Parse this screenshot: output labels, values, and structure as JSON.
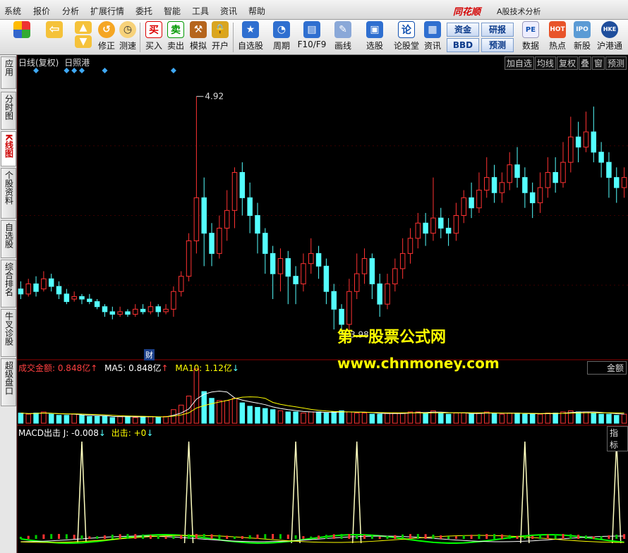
{
  "menu": {
    "items": [
      "系统",
      "报价",
      "分析",
      "扩展行情",
      "委托",
      "智能",
      "工具",
      "资讯",
      "帮助"
    ],
    "brand": "同花顺",
    "app_title": "A股技术分析"
  },
  "toolbar": {
    "buttons": [
      {
        "label": "",
        "icon": "grid-icon"
      },
      {
        "label": "",
        "icon": "back-arrow-icon"
      },
      {
        "label": "",
        "icon": "up-arrow-icon"
      },
      {
        "label": "修正",
        "icon": "fix-icon"
      },
      {
        "label": "测速",
        "icon": "clock-icon"
      },
      {
        "label": "买入",
        "icon": "buy-icon"
      },
      {
        "label": "卖出",
        "icon": "sell-icon"
      },
      {
        "label": "模拟",
        "icon": "hammer-icon"
      },
      {
        "label": "开户",
        "icon": "lock-icon"
      },
      {
        "label": "自选股",
        "icon": "star-icon"
      },
      {
        "label": "周期",
        "icon": "cycle-icon"
      },
      {
        "label": "F10/F9",
        "icon": "f10-icon"
      },
      {
        "label": "画线",
        "icon": "pen-icon"
      },
      {
        "label": "选股",
        "icon": "select-stock-icon"
      },
      {
        "label": "论股堂",
        "icon": "forum-icon"
      },
      {
        "label": "资讯",
        "icon": "news-icon"
      },
      {
        "label": "数据",
        "icon": "pe-icon"
      },
      {
        "label": "热点",
        "icon": "hot-icon"
      },
      {
        "label": "新股",
        "icon": "ipo-icon"
      },
      {
        "label": "沪港通",
        "icon": "hk-connect-icon"
      }
    ],
    "small_buttons": [
      "资金",
      "研报",
      "BBD",
      "预测"
    ]
  },
  "sidebar": {
    "items": [
      "应用",
      "分时图",
      "K线图",
      "个股资料",
      "自选股",
      "综合排名",
      "牛叉诊股",
      "超级盘口"
    ]
  },
  "chart_header": {
    "label": "日线(复权)",
    "stock": "日照港"
  },
  "right_buttons": [
    "加自选",
    "均线",
    "复权",
    "叠",
    "窗",
    "预测"
  ],
  "volume_panel": {
    "label_amount": "成交金额: 0.848亿",
    "label_ma5": "MA5: 0.848亿",
    "label_ma10": "MA10: 1.12亿",
    "right_box": "金额",
    "marker": "财"
  },
  "macd_panel": {
    "label": "MACD出击 J: -0.008",
    "label2": "出击: +0",
    "right_box": "指标"
  },
  "watermark": {
    "line1": "第一股票公式网",
    "line2": "www.chnmoney.com"
  },
  "colors": {
    "up": "#ff3232",
    "down": "#54ffff",
    "bg": "#000000",
    "ma5": "#ffffff",
    "ma10": "#ffff00",
    "watermark": "#ffff00"
  },
  "chart_data": {
    "type": "candlestick",
    "price_high_label": "4.92",
    "price_low_label": "3.98",
    "ylim": [
      3.9,
      5.0
    ],
    "candles": [
      [
        4.16,
        4.14,
        4.19,
        4.12
      ],
      [
        4.14,
        4.18,
        4.2,
        4.13
      ],
      [
        4.18,
        4.15,
        4.21,
        4.13
      ],
      [
        4.16,
        4.2,
        4.23,
        4.15
      ],
      [
        4.2,
        4.17,
        4.22,
        4.15
      ],
      [
        4.17,
        4.14,
        4.19,
        4.12
      ],
      [
        4.14,
        4.11,
        4.16,
        4.1
      ],
      [
        4.12,
        4.13,
        4.15,
        4.11
      ],
      [
        4.13,
        4.12,
        4.14,
        4.1
      ],
      [
        4.12,
        4.11,
        4.14,
        4.1
      ],
      [
        4.11,
        4.09,
        4.12,
        4.08
      ],
      [
        4.09,
        4.07,
        4.1,
        4.05
      ],
      [
        4.07,
        4.06,
        4.09,
        4.04
      ],
      [
        4.06,
        4.07,
        4.09,
        4.05
      ],
      [
        4.07,
        4.06,
        4.08,
        4.05
      ],
      [
        4.06,
        4.08,
        4.1,
        4.05
      ],
      [
        4.08,
        4.07,
        4.1,
        4.06
      ],
      [
        4.07,
        4.09,
        4.11,
        4.06
      ],
      [
        4.09,
        4.07,
        4.1,
        4.05
      ],
      [
        4.07,
        4.08,
        4.1,
        4.06
      ],
      [
        4.08,
        4.15,
        4.17,
        4.05
      ],
      [
        4.15,
        4.21,
        4.23,
        4.13
      ],
      [
        4.21,
        4.35,
        4.38,
        4.19
      ],
      [
        4.35,
        4.52,
        4.92,
        4.3
      ],
      [
        4.52,
        4.38,
        4.6,
        4.25
      ],
      [
        4.38,
        4.3,
        4.42,
        4.25
      ],
      [
        4.3,
        4.4,
        4.45,
        4.28
      ],
      [
        4.4,
        4.47,
        4.55,
        4.35
      ],
      [
        4.47,
        4.62,
        4.64,
        4.4
      ],
      [
        4.62,
        4.52,
        4.66,
        4.45
      ],
      [
        4.52,
        4.45,
        4.58,
        4.38
      ],
      [
        4.45,
        4.38,
        4.5,
        4.3
      ],
      [
        4.38,
        4.3,
        4.4,
        4.22
      ],
      [
        4.3,
        4.22,
        4.33,
        4.12
      ],
      [
        4.22,
        4.28,
        4.32,
        4.15
      ],
      [
        4.28,
        4.21,
        4.31,
        4.1
      ],
      [
        4.21,
        4.18,
        4.25,
        4.1
      ],
      [
        4.18,
        4.26,
        4.3,
        4.15
      ],
      [
        4.26,
        4.3,
        4.36,
        4.22
      ],
      [
        4.3,
        4.25,
        4.33,
        4.2
      ],
      [
        4.25,
        4.15,
        4.28,
        4.1
      ],
      [
        4.15,
        4.08,
        4.18,
        4.0
      ],
      [
        4.08,
        4.02,
        4.1,
        3.98
      ],
      [
        4.02,
        4.15,
        4.2,
        4.0
      ],
      [
        4.15,
        4.22,
        4.3,
        4.12
      ],
      [
        4.22,
        4.28,
        4.32,
        4.18
      ],
      [
        4.28,
        4.18,
        4.3,
        4.12
      ],
      [
        4.18,
        4.1,
        4.22,
        4.05
      ],
      [
        4.1,
        4.18,
        4.22,
        4.08
      ],
      [
        4.18,
        4.24,
        4.28,
        4.15
      ],
      [
        4.24,
        4.3,
        4.36,
        4.2
      ],
      [
        4.3,
        4.36,
        4.4,
        4.26
      ],
      [
        4.36,
        4.42,
        4.46,
        4.32
      ],
      [
        4.42,
        4.38,
        4.46,
        4.33
      ],
      [
        4.38,
        4.44,
        4.6,
        4.35
      ],
      [
        4.44,
        4.4,
        4.48,
        4.36
      ],
      [
        4.4,
        4.38,
        4.44,
        4.33
      ],
      [
        4.38,
        4.45,
        4.5,
        4.35
      ],
      [
        4.45,
        4.52,
        4.55,
        4.42
      ],
      [
        4.52,
        4.48,
        4.58,
        4.44
      ],
      [
        4.48,
        4.55,
        4.62,
        4.46
      ],
      [
        4.55,
        4.6,
        4.68,
        4.52
      ],
      [
        4.6,
        4.54,
        4.65,
        4.5
      ],
      [
        4.54,
        4.58,
        4.62,
        4.5
      ],
      [
        4.58,
        4.65,
        4.7,
        4.55
      ],
      [
        4.65,
        4.6,
        4.72,
        4.56
      ],
      [
        4.6,
        4.54,
        4.64,
        4.48
      ],
      [
        4.54,
        4.5,
        4.58,
        4.44
      ],
      [
        4.5,
        4.56,
        4.62,
        4.46
      ],
      [
        4.56,
        4.62,
        4.68,
        4.52
      ],
      [
        4.62,
        4.58,
        4.68,
        4.54
      ],
      [
        4.58,
        4.66,
        4.74,
        4.56
      ],
      [
        4.66,
        4.76,
        4.84,
        4.62
      ],
      [
        4.76,
        4.72,
        4.82,
        4.66
      ],
      [
        4.72,
        4.78,
        4.86,
        4.7
      ],
      [
        4.78,
        4.7,
        4.88,
        4.66
      ],
      [
        4.7,
        4.66,
        4.74,
        4.6
      ],
      [
        4.66,
        4.6,
        4.7,
        4.52
      ],
      [
        4.6,
        4.56,
        4.64,
        4.5
      ],
      [
        4.56,
        4.6,
        4.64,
        4.52
      ]
    ],
    "volume": [
      0.9,
      0.8,
      0.9,
      1.0,
      0.8,
      0.7,
      0.7,
      0.8,
      0.7,
      0.6,
      0.6,
      0.6,
      0.5,
      0.6,
      0.6,
      0.5,
      0.6,
      0.6,
      0.5,
      0.6,
      1.2,
      1.6,
      2.4,
      4.8,
      2.8,
      2.2,
      2.0,
      2.0,
      2.2,
      1.8,
      1.5,
      1.4,
      1.3,
      1.2,
      1.1,
      1.0,
      1.0,
      0.9,
      1.0,
      1.0,
      0.9,
      1.0,
      1.1,
      1.0,
      0.9,
      0.9,
      0.8,
      0.8,
      0.9,
      0.9,
      0.9,
      1.0,
      1.0,
      0.9,
      1.1,
      0.9,
      0.8,
      0.9,
      0.9,
      0.8,
      0.9,
      1.0,
      0.9,
      0.8,
      0.9,
      0.9,
      0.8,
      0.8,
      0.8,
      0.9,
      0.9,
      1.0,
      1.1,
      1.0,
      1.0,
      0.9,
      0.8,
      0.8,
      0.7,
      0.8
    ],
    "signal_peaks": [
      8,
      22,
      36,
      44,
      66,
      78
    ]
  }
}
